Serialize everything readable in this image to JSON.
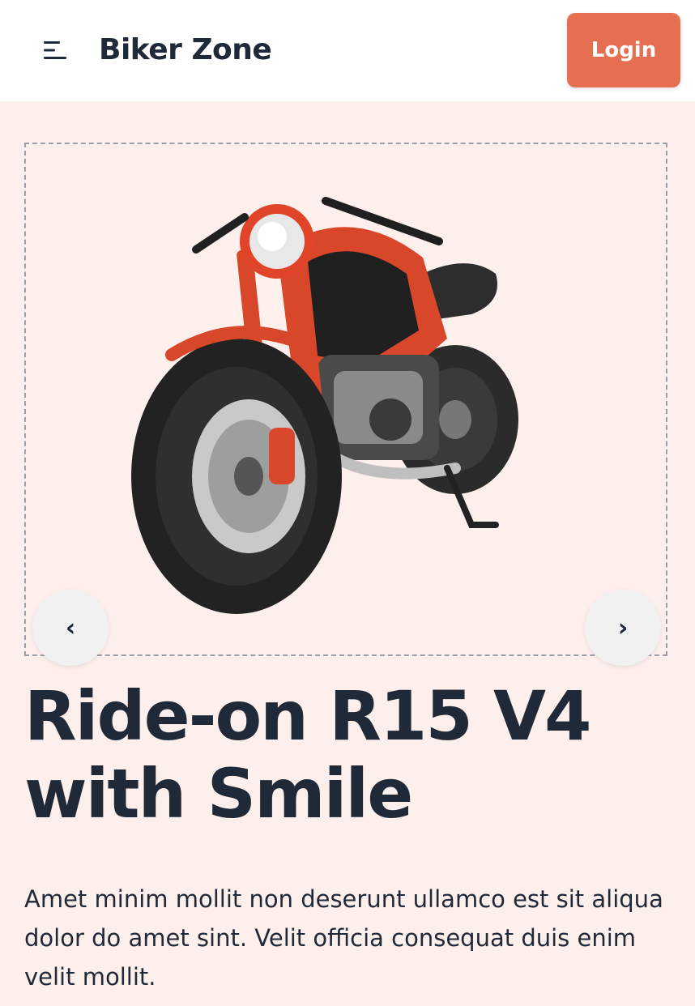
{
  "header": {
    "brand": "Biker Zone",
    "login_label": "Login",
    "menu_icon": "hamburger-menu-icon"
  },
  "hero": {
    "image_icon": "motorcycle-image",
    "prev_label": "‹",
    "next_label": "›",
    "headline": "Ride-on R15 V4 with Smile",
    "description": "Amet minim mollit non deserunt ullamco est sit aliqua dolor do amet sint. Velit officia consequat duis enim velit mollit."
  },
  "colors": {
    "background": "#fcefec",
    "accent": "#e76f51",
    "text": "#1f2937",
    "header_bg": "#ffffff"
  }
}
